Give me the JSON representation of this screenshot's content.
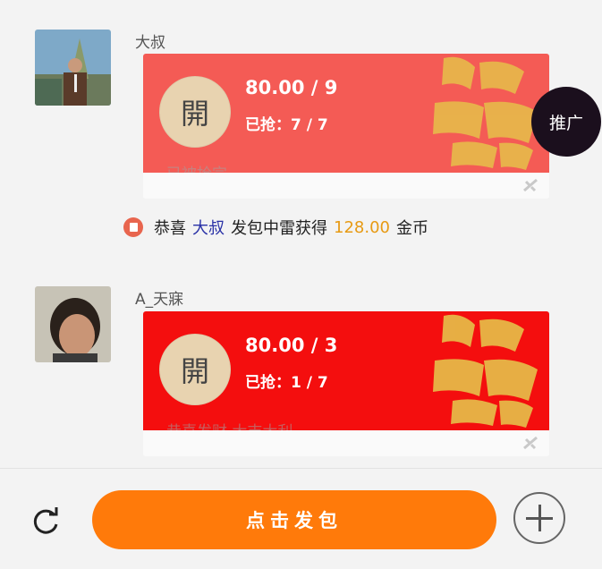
{
  "messages": [
    {
      "sender": "大叔",
      "amount": "80.00 / 9",
      "grabbed": "已抢：7 / 7",
      "coin_label": "開",
      "status_text": "已被抢完",
      "card_color": "#f45b55"
    },
    {
      "sender": "A_天寐",
      "amount": "80.00 / 3",
      "grabbed": "已抢：1 / 7",
      "coin_label": "開",
      "status_text": "恭喜发财,大吉大利",
      "card_color": "#f40e0e"
    }
  ],
  "notice": {
    "prefix": "恭喜",
    "user": "大叔",
    "middle": "发包中雷获得",
    "amount": "128.00",
    "suffix": "金币"
  },
  "promo_label": "推广",
  "send_button_label": "点击发包",
  "colors": {
    "accent": "#ff7a0a",
    "user_link": "#2830a6",
    "gold": "#e79a13"
  },
  "icons": [
    "refresh-icon",
    "plus-icon",
    "red-packet-icon",
    "envelope-small-icon"
  ]
}
